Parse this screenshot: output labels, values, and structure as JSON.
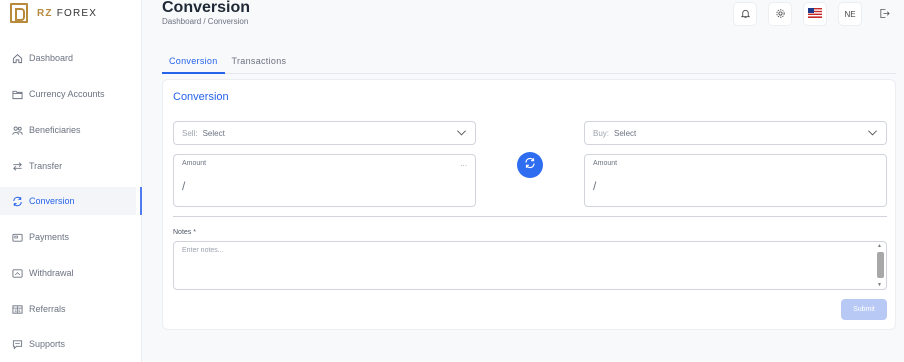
{
  "brand": {
    "name_part1": "RZ",
    "name_part2": "FOREX"
  },
  "sidebar": {
    "items": [
      {
        "label": "Dashboard",
        "icon": "home-icon"
      },
      {
        "label": "Currency Accounts",
        "icon": "folder-icon"
      },
      {
        "label": "Beneficiaries",
        "icon": "users-icon"
      },
      {
        "label": "Transfer",
        "icon": "arrows-icon"
      },
      {
        "label": "Conversion",
        "icon": "sync-icon",
        "active": true
      },
      {
        "label": "Payments",
        "icon": "payment-icon"
      },
      {
        "label": "Withdrawal",
        "icon": "withdraw-icon"
      },
      {
        "label": "Referrals",
        "icon": "referral-icon"
      },
      {
        "label": "Supports",
        "icon": "chat-icon"
      }
    ]
  },
  "header": {
    "title": "Conversion",
    "breadcrumb": "Dashboard / Conversion",
    "language": "NE"
  },
  "tabs": [
    {
      "label": "Conversion",
      "active": true
    },
    {
      "label": "Transactions",
      "active": false
    }
  ],
  "form": {
    "title": "Conversion",
    "sell": {
      "label": "Sell:",
      "value": "Select"
    },
    "buy": {
      "label": "Buy:",
      "value": "Select"
    },
    "amount_sell": {
      "label": "Amount",
      "value": "/",
      "extra": "..."
    },
    "amount_buy": {
      "label": "Amount",
      "value": "/"
    },
    "notes_label": "Notes *",
    "notes_placeholder": "Enter notes...",
    "submit_label": "Submit"
  },
  "colors": {
    "accent": "#2563eb",
    "brand_gold": "#b88a3e",
    "submit_disabled": "#b8c9f6"
  }
}
